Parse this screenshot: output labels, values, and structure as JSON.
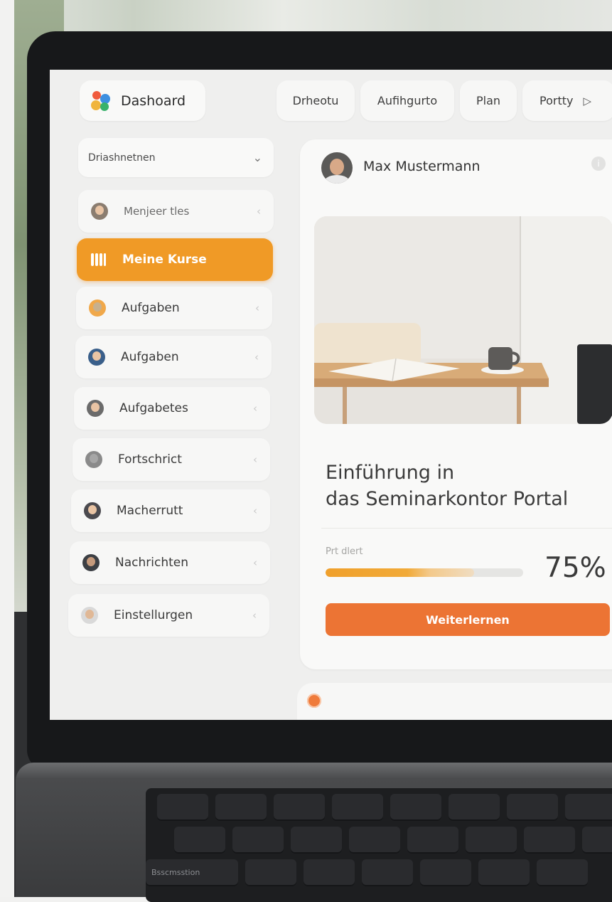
{
  "header": {
    "brand_label": "Dashoard",
    "nav": [
      {
        "label": "Drheotu"
      },
      {
        "label": "Aufihgurto"
      },
      {
        "label": "Plan"
      },
      {
        "label": "Portty"
      }
    ]
  },
  "sidebar": {
    "dropdown_label": "Driashnetnen",
    "items": [
      {
        "label": "Menjeer tles",
        "active": false
      },
      {
        "label": "Meine Kurse",
        "active": true
      },
      {
        "label": "Aufgaben",
        "active": false
      },
      {
        "label": "Aufgaben",
        "active": false
      },
      {
        "label": "Aufgabetes",
        "active": false
      },
      {
        "label": "Fortschrict",
        "active": false
      },
      {
        "label": "Macherrutt",
        "active": false
      },
      {
        "label": "Nachrichten",
        "active": false
      },
      {
        "label": "Einstellurgen",
        "active": false
      }
    ]
  },
  "main": {
    "user_name": "Max Mustermann",
    "course_title_line1": "Einführung in",
    "course_title_line2": "das Seminarkontor Portal",
    "progress_label": "Prt dlert",
    "progress_percent": 75,
    "progress_value_text": "75%",
    "cta_label": "Weiterlernen"
  },
  "keyboard": {
    "key_label": "Bsscmsstion"
  },
  "colors": {
    "accent_orange": "#f09a26",
    "cta_orange": "#ec7434",
    "screen_bg": "#efefee"
  },
  "icons": {
    "brand": "dashboard-logo-icon",
    "nav_more": "play-arrow-icon",
    "dropdown": "chevron-down-icon",
    "item_arrow": "chevron-right-icon",
    "info": "info-icon"
  }
}
